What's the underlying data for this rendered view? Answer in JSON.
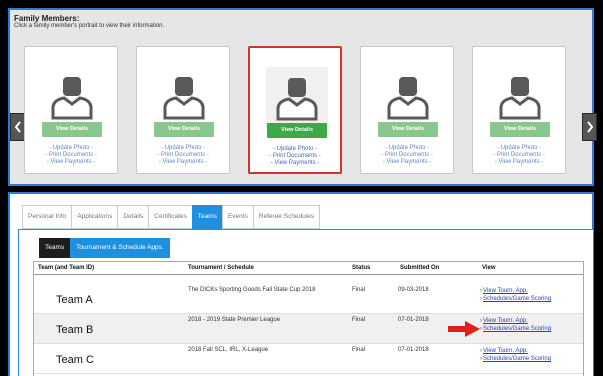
{
  "family": {
    "title": "Family Members:",
    "subtitle": "Click a family member's portrait to view their information.",
    "cards": [
      {
        "button": "View Details",
        "links": [
          "- Update Photo -",
          "- Print Documents -",
          "- View Payments -"
        ]
      },
      {
        "button": "View Details",
        "links": [
          "- Update Photo -",
          "- Print Documents -",
          "- View Payments -"
        ]
      },
      {
        "button": "View Details",
        "links": [
          "- Update Photo -",
          "- Print Documents -",
          "- View Payments -"
        ]
      },
      {
        "button": "View Details",
        "links": [
          "- Update Photo -",
          "- Print Documents -",
          "- View Payments -"
        ]
      },
      {
        "button": "View Details",
        "links": [
          "- Update Photo -",
          "- Print Documents -",
          "- View Payments -"
        ]
      }
    ],
    "selected_card_index": 2,
    "arrow_icons": [
      "chevron-left-icon",
      "chevron-right-icon"
    ]
  },
  "tabs": [
    "Personal Info",
    "Applications",
    "Details",
    "Certificates",
    "Teams",
    "Events",
    "Referee Schedules"
  ],
  "active_tab": "Teams",
  "subtabs": [
    "Teams",
    "Tournament & Schedule Apps."
  ],
  "table": {
    "headers": [
      "Team (and Team ID)",
      "Tournament / Schedule",
      "Status",
      "Submitted On",
      "View"
    ],
    "rows": [
      {
        "team": "Team A",
        "tournament": "The DICKs Sporting Goods Fall State Cup 2018",
        "status": "Final",
        "submitted": "09-03-2018",
        "links": [
          "View Tourn. App.",
          "Schedules/Game Scoring"
        ]
      },
      {
        "team": "Team B",
        "tournament": "2018 - 2019 State Premier League",
        "status": "Final",
        "submitted": "07-01-2018",
        "links": [
          "View Tourn. App.",
          "Schedules/Game Scoring"
        ]
      },
      {
        "team": "Team C",
        "tournament": "2018 Fall SCL, IRL, X-League",
        "status": "Final",
        "submitted": "07-01-2018",
        "links": [
          "View Tourn. App.",
          "Schedules/Game Scoring"
        ]
      }
    ]
  },
  "colors": {
    "accent": "#1f8fe0",
    "panel_border": "#2b7bd8",
    "selected_card": "#d0342c",
    "button_green": "#3ea84a",
    "arrow": "#e0201c"
  }
}
